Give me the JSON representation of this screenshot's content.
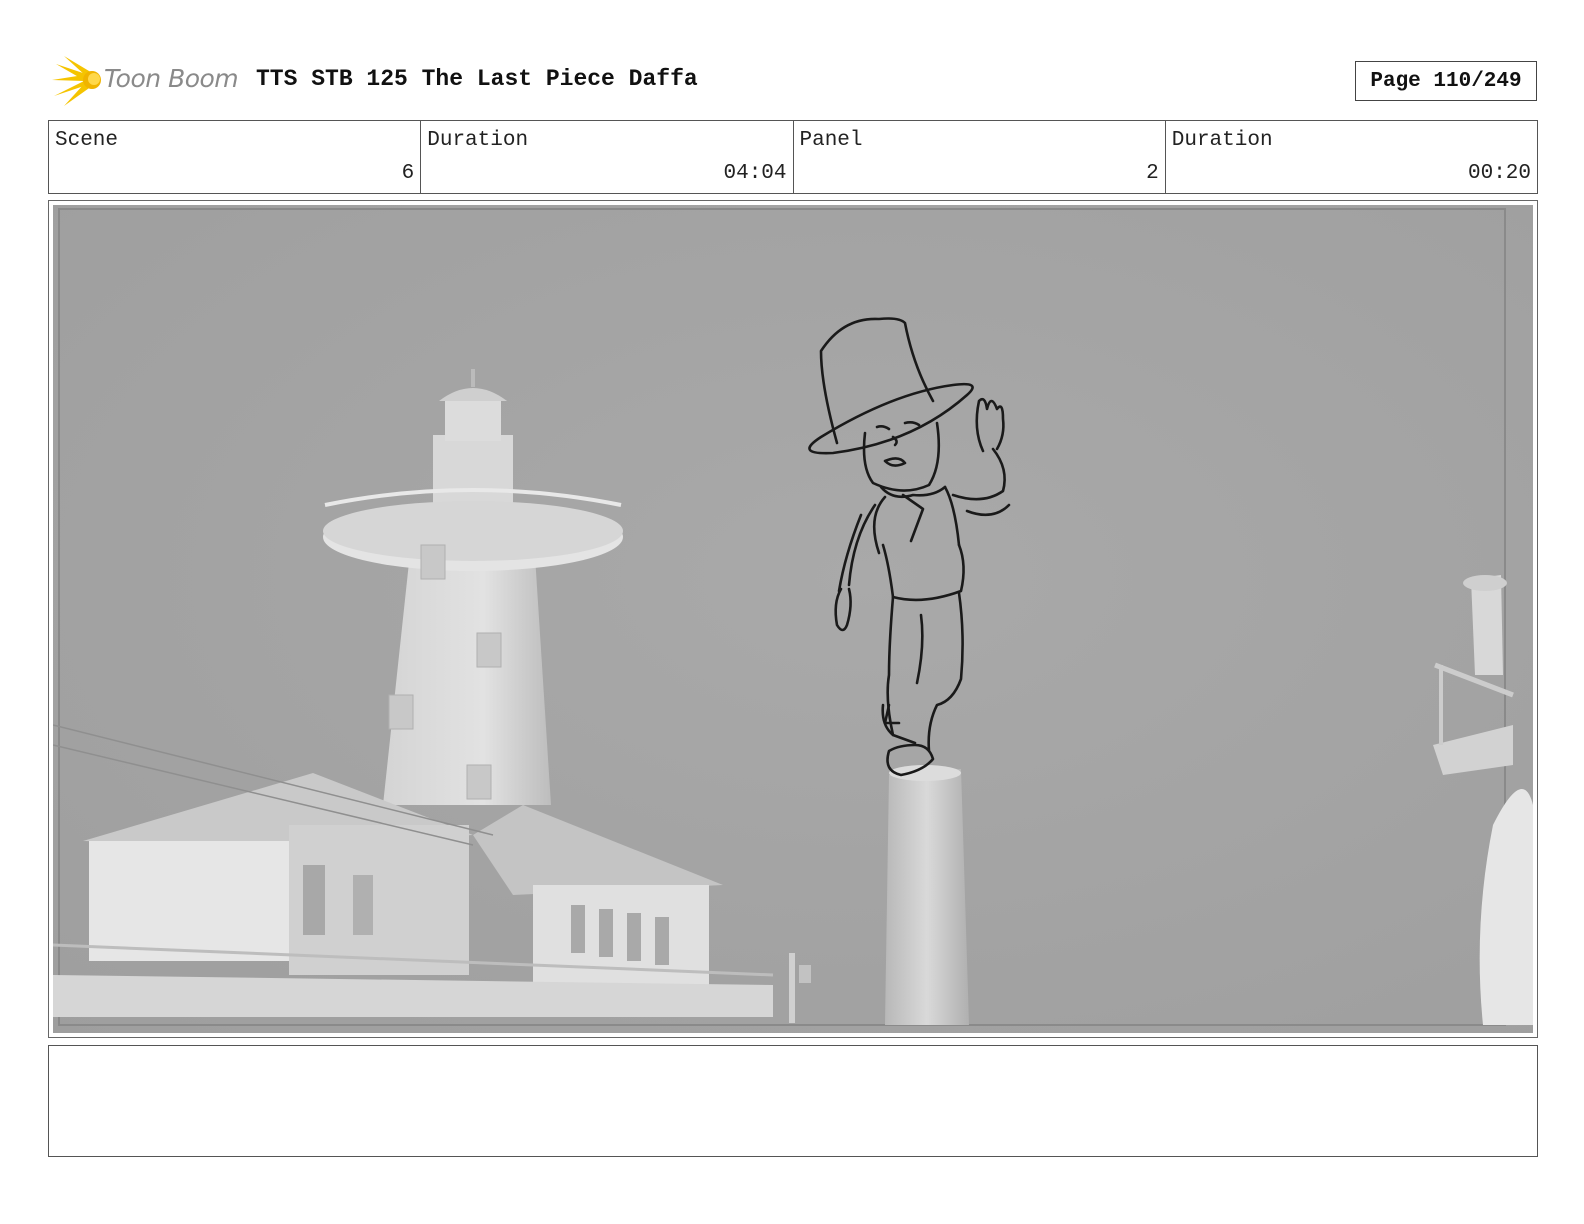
{
  "header": {
    "logo_text": "Toon Boom",
    "title": "TTS STB 125 The Last Piece Daffa",
    "page": "Page 110/249"
  },
  "info": {
    "scene_label": "Scene",
    "scene_value": "6",
    "scene_duration_label": "Duration",
    "scene_duration_value": "04:04",
    "panel_label": "Panel",
    "panel_value": "2",
    "panel_duration_label": "Duration",
    "panel_duration_value": "00:20"
  },
  "notes": {
    "text": ""
  },
  "colors": {
    "sky": "#a6a6a6",
    "logo_flame": "#f5c400",
    "sketch_line": "#1a1a1a"
  }
}
